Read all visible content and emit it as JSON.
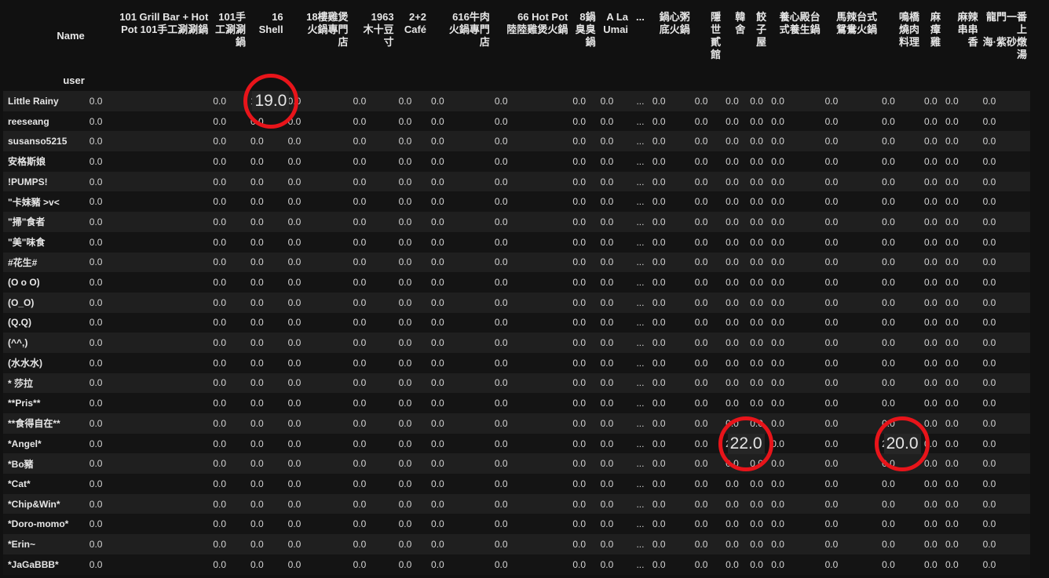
{
  "table": {
    "name_header": "Name",
    "index_header": "user",
    "columns": [
      "101 Grill Bar + Hot\nPot 101手工涮涮鍋",
      "101手\n工涮涮\n鍋",
      "16\nShell",
      "18樓雞煲\n火鍋專門\n店",
      "1963\n木十豆\n寸",
      "2+2\nCafé",
      "616牛肉\n火鍋專門\n店",
      "66 Hot Pot\n陸陸雞煲火鍋",
      "8鍋\n臭臭\n鍋",
      "A La\nUmai",
      "...",
      "鍋心粥\n底火鍋",
      "隱\n世\n貳\n館",
      "韓\n舍",
      "餃\n子\n屋",
      "養心殿台\n式養生鍋",
      "馬辣台式\n鴛鴦火鍋",
      "鳴橋\n燒肉\n料理",
      "麻\n瘴\n雞",
      "麻辣\n串串\n香",
      "龍門一番 上\n海·紫砂燉湯"
    ],
    "rows": [
      {
        "user": "Little Rainy",
        "values": [
          "0.0",
          "0.0",
          "19.0",
          "0.0",
          "0.0",
          "0.0",
          "0.0",
          "0.0",
          "0.0",
          "0.0",
          "...",
          "0.0",
          "0.0",
          "0.0",
          "0.0",
          "0.0",
          "0.0",
          "0.0",
          "0.0",
          "0.0",
          "0.0"
        ]
      },
      {
        "user": "reeseang",
        "values": [
          "0.0",
          "0.0",
          "0.0",
          "0.0",
          "0.0",
          "0.0",
          "0.0",
          "0.0",
          "0.0",
          "0.0",
          "...",
          "0.0",
          "0.0",
          "0.0",
          "0.0",
          "0.0",
          "0.0",
          "0.0",
          "0.0",
          "0.0",
          "0.0"
        ]
      },
      {
        "user": "susanso5215",
        "values": [
          "0.0",
          "0.0",
          "0.0",
          "0.0",
          "0.0",
          "0.0",
          "0.0",
          "0.0",
          "0.0",
          "0.0",
          "...",
          "0.0",
          "0.0",
          "0.0",
          "0.0",
          "0.0",
          "0.0",
          "0.0",
          "0.0",
          "0.0",
          "0.0"
        ]
      },
      {
        "user": "安格斯娘",
        "values": [
          "0.0",
          "0.0",
          "0.0",
          "0.0",
          "0.0",
          "0.0",
          "0.0",
          "0.0",
          "0.0",
          "0.0",
          "...",
          "0.0",
          "0.0",
          "0.0",
          "0.0",
          "0.0",
          "0.0",
          "0.0",
          "0.0",
          "0.0",
          "0.0"
        ]
      },
      {
        "user": "!PUMPS!",
        "values": [
          "0.0",
          "0.0",
          "0.0",
          "0.0",
          "0.0",
          "0.0",
          "0.0",
          "0.0",
          "0.0",
          "0.0",
          "...",
          "0.0",
          "0.0",
          "0.0",
          "0.0",
          "0.0",
          "0.0",
          "0.0",
          "0.0",
          "0.0",
          "0.0"
        ]
      },
      {
        "user": "\"卡妹豬 >v<",
        "values": [
          "0.0",
          "0.0",
          "0.0",
          "0.0",
          "0.0",
          "0.0",
          "0.0",
          "0.0",
          "0.0",
          "0.0",
          "...",
          "0.0",
          "0.0",
          "0.0",
          "0.0",
          "0.0",
          "0.0",
          "0.0",
          "0.0",
          "0.0",
          "0.0"
        ]
      },
      {
        "user": "\"掃\"食者",
        "values": [
          "0.0",
          "0.0",
          "0.0",
          "0.0",
          "0.0",
          "0.0",
          "0.0",
          "0.0",
          "0.0",
          "0.0",
          "...",
          "0.0",
          "0.0",
          "0.0",
          "0.0",
          "0.0",
          "0.0",
          "0.0",
          "0.0",
          "0.0",
          "0.0"
        ]
      },
      {
        "user": "\"美\"味食",
        "values": [
          "0.0",
          "0.0",
          "0.0",
          "0.0",
          "0.0",
          "0.0",
          "0.0",
          "0.0",
          "0.0",
          "0.0",
          "...",
          "0.0",
          "0.0",
          "0.0",
          "0.0",
          "0.0",
          "0.0",
          "0.0",
          "0.0",
          "0.0",
          "0.0"
        ]
      },
      {
        "user": "#花生#",
        "values": [
          "0.0",
          "0.0",
          "0.0",
          "0.0",
          "0.0",
          "0.0",
          "0.0",
          "0.0",
          "0.0",
          "0.0",
          "...",
          "0.0",
          "0.0",
          "0.0",
          "0.0",
          "0.0",
          "0.0",
          "0.0",
          "0.0",
          "0.0",
          "0.0"
        ]
      },
      {
        "user": "(O o O)",
        "values": [
          "0.0",
          "0.0",
          "0.0",
          "0.0",
          "0.0",
          "0.0",
          "0.0",
          "0.0",
          "0.0",
          "0.0",
          "...",
          "0.0",
          "0.0",
          "0.0",
          "0.0",
          "0.0",
          "0.0",
          "0.0",
          "0.0",
          "0.0",
          "0.0"
        ]
      },
      {
        "user": "(O_O)",
        "values": [
          "0.0",
          "0.0",
          "0.0",
          "0.0",
          "0.0",
          "0.0",
          "0.0",
          "0.0",
          "0.0",
          "0.0",
          "...",
          "0.0",
          "0.0",
          "0.0",
          "0.0",
          "0.0",
          "0.0",
          "0.0",
          "0.0",
          "0.0",
          "0.0"
        ]
      },
      {
        "user": "(Q.Q)",
        "values": [
          "0.0",
          "0.0",
          "0.0",
          "0.0",
          "0.0",
          "0.0",
          "0.0",
          "0.0",
          "0.0",
          "0.0",
          "...",
          "0.0",
          "0.0",
          "0.0",
          "0.0",
          "0.0",
          "0.0",
          "0.0",
          "0.0",
          "0.0",
          "0.0"
        ]
      },
      {
        "user": "(^^,)",
        "values": [
          "0.0",
          "0.0",
          "0.0",
          "0.0",
          "0.0",
          "0.0",
          "0.0",
          "0.0",
          "0.0",
          "0.0",
          "...",
          "0.0",
          "0.0",
          "0.0",
          "0.0",
          "0.0",
          "0.0",
          "0.0",
          "0.0",
          "0.0",
          "0.0"
        ]
      },
      {
        "user": "(水水水)",
        "values": [
          "0.0",
          "0.0",
          "0.0",
          "0.0",
          "0.0",
          "0.0",
          "0.0",
          "0.0",
          "0.0",
          "0.0",
          "...",
          "0.0",
          "0.0",
          "0.0",
          "0.0",
          "0.0",
          "0.0",
          "0.0",
          "0.0",
          "0.0",
          "0.0"
        ]
      },
      {
        "user": "* 莎拉",
        "values": [
          "0.0",
          "0.0",
          "0.0",
          "0.0",
          "0.0",
          "0.0",
          "0.0",
          "0.0",
          "0.0",
          "0.0",
          "...",
          "0.0",
          "0.0",
          "0.0",
          "0.0",
          "0.0",
          "0.0",
          "0.0",
          "0.0",
          "0.0",
          "0.0"
        ]
      },
      {
        "user": "**Pris**",
        "values": [
          "0.0",
          "0.0",
          "0.0",
          "0.0",
          "0.0",
          "0.0",
          "0.0",
          "0.0",
          "0.0",
          "0.0",
          "...",
          "0.0",
          "0.0",
          "0.0",
          "0.0",
          "0.0",
          "0.0",
          "0.0",
          "0.0",
          "0.0",
          "0.0"
        ]
      },
      {
        "user": "**食得自在**",
        "values": [
          "0.0",
          "0.0",
          "0.0",
          "0.0",
          "0.0",
          "0.0",
          "0.0",
          "0.0",
          "0.0",
          "0.0",
          "...",
          "0.0",
          "0.0",
          "0.0",
          "0.0",
          "0.0",
          "0.0",
          "0.0",
          "0.0",
          "0.0",
          "0.0"
        ]
      },
      {
        "user": "*Angel*",
        "values": [
          "0.0",
          "0.0",
          "0.0",
          "0.0",
          "0.0",
          "0.0",
          "0.0",
          "0.0",
          "0.0",
          "0.0",
          "...",
          "0.0",
          "0.0",
          "22.0",
          "0.0",
          "0.0",
          "0.0",
          "20.0",
          "0.0",
          "0.0",
          "0.0"
        ]
      },
      {
        "user": "*Bo豬",
        "values": [
          "0.0",
          "0.0",
          "0.0",
          "0.0",
          "0.0",
          "0.0",
          "0.0",
          "0.0",
          "0.0",
          "0.0",
          "...",
          "0.0",
          "0.0",
          "0.0",
          "0.0",
          "0.0",
          "0.0",
          "0.0",
          "0.0",
          "0.0",
          "0.0"
        ]
      },
      {
        "user": "*Cat*",
        "values": [
          "0.0",
          "0.0",
          "0.0",
          "0.0",
          "0.0",
          "0.0",
          "0.0",
          "0.0",
          "0.0",
          "0.0",
          "...",
          "0.0",
          "0.0",
          "0.0",
          "0.0",
          "0.0",
          "0.0",
          "0.0",
          "0.0",
          "0.0",
          "0.0"
        ]
      },
      {
        "user": "*Chip&Win*",
        "values": [
          "0.0",
          "0.0",
          "0.0",
          "0.0",
          "0.0",
          "0.0",
          "0.0",
          "0.0",
          "0.0",
          "0.0",
          "...",
          "0.0",
          "0.0",
          "0.0",
          "0.0",
          "0.0",
          "0.0",
          "0.0",
          "0.0",
          "0.0",
          "0.0"
        ]
      },
      {
        "user": "*Doro-momo*",
        "values": [
          "0.0",
          "0.0",
          "0.0",
          "0.0",
          "0.0",
          "0.0",
          "0.0",
          "0.0",
          "0.0",
          "0.0",
          "...",
          "0.0",
          "0.0",
          "0.0",
          "0.0",
          "0.0",
          "0.0",
          "0.0",
          "0.0",
          "0.0",
          "0.0"
        ]
      },
      {
        "user": "*Erin~",
        "values": [
          "0.0",
          "0.0",
          "0.0",
          "0.0",
          "0.0",
          "0.0",
          "0.0",
          "0.0",
          "0.0",
          "0.0",
          "...",
          "0.0",
          "0.0",
          "0.0",
          "0.0",
          "0.0",
          "0.0",
          "0.0",
          "0.0",
          "0.0",
          "0.0"
        ]
      },
      {
        "user": "*JaGaBBB*",
        "values": [
          "0.0",
          "0.0",
          "0.0",
          "0.0",
          "0.0",
          "0.0",
          "0.0",
          "0.0",
          "0.0",
          "0.0",
          "...",
          "0.0",
          "0.0",
          "0.0",
          "0.0",
          "0.0",
          "0.0",
          "0.0",
          "0.0",
          "0.0",
          "0.0"
        ]
      }
    ]
  },
  "highlights": [
    {
      "row": 0,
      "col": 2,
      "value": "19.0"
    },
    {
      "row": 17,
      "col": 13,
      "value": "22.0"
    },
    {
      "row": 17,
      "col": 17,
      "value": "20.0"
    }
  ],
  "colors": {
    "background": "#111111",
    "row_odd": "#1f1f1f",
    "row_even": "#141414",
    "text": "#d4d4d4",
    "annotation_circle": "#e8141a"
  }
}
